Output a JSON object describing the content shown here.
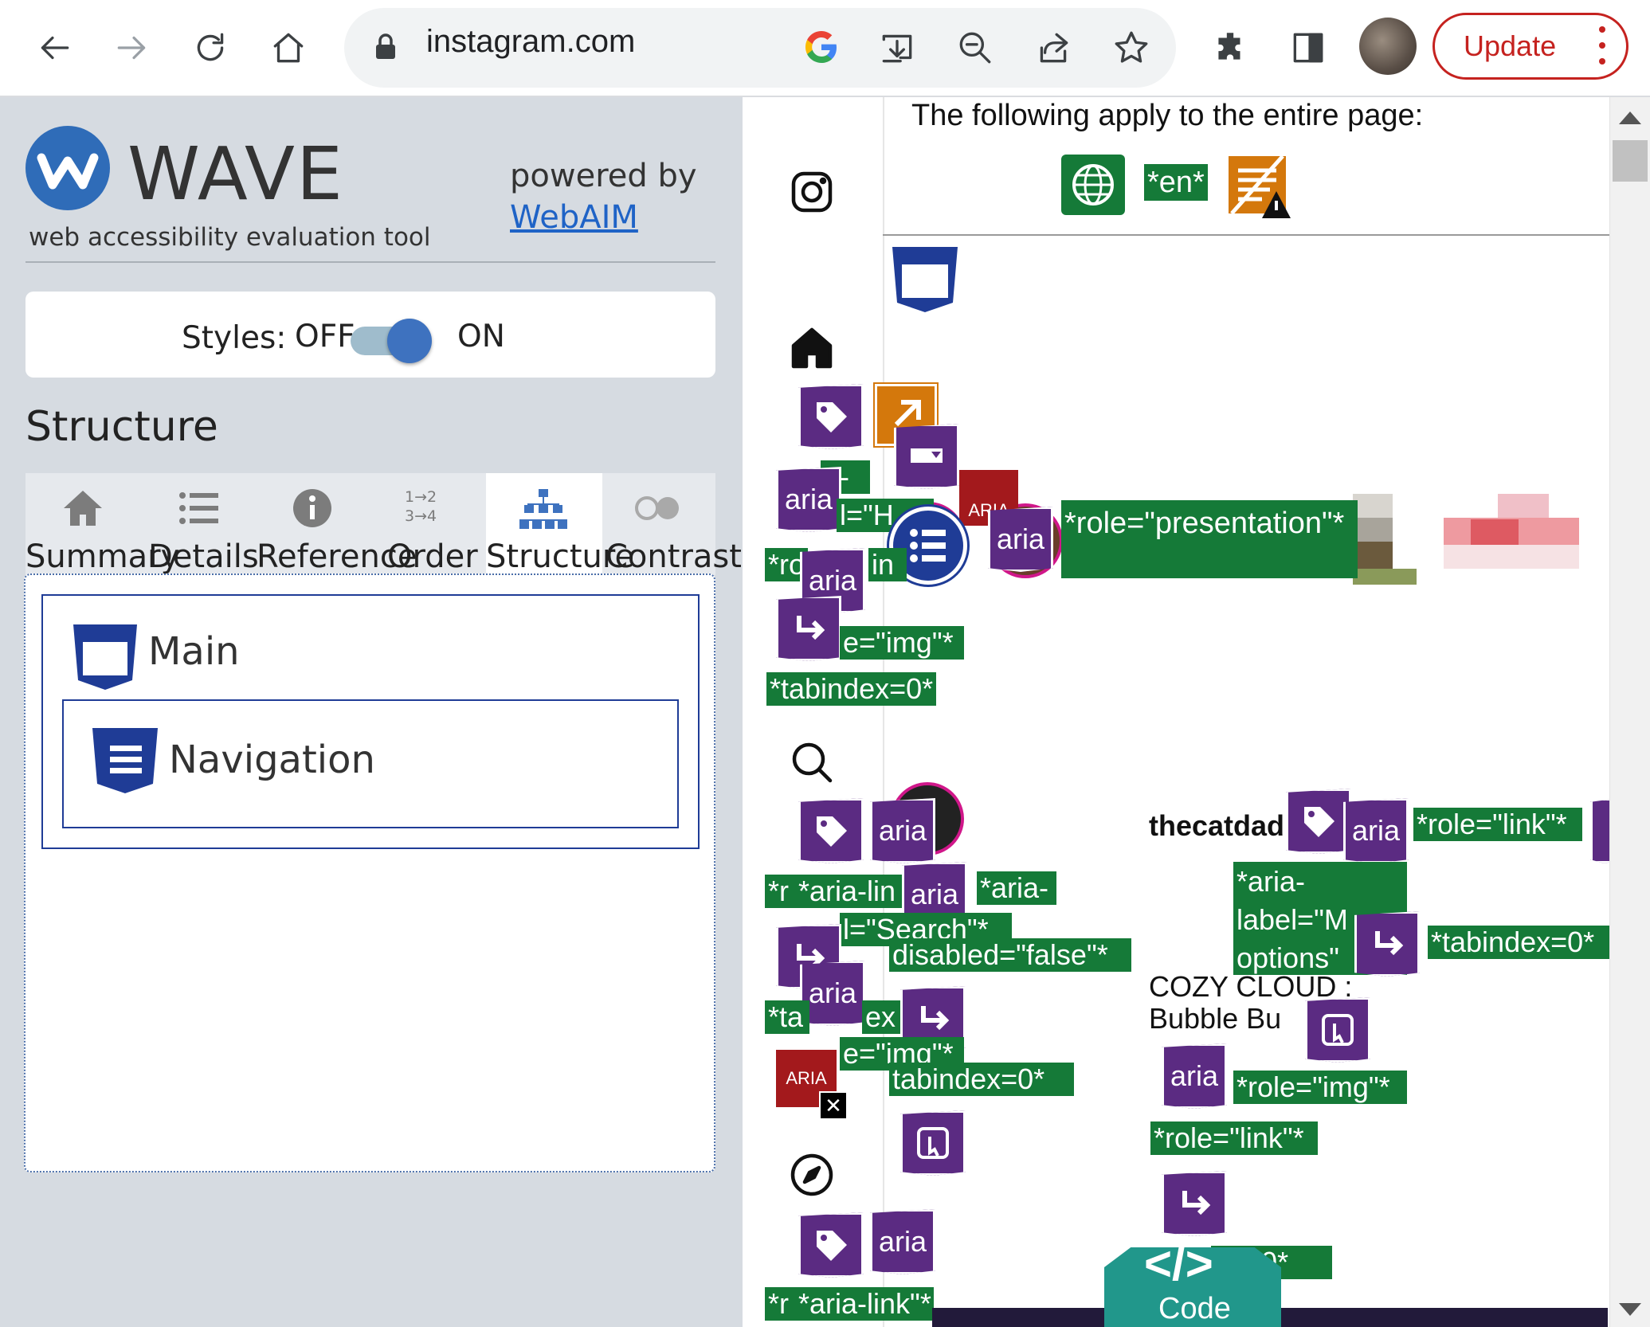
{
  "browser": {
    "url": "instagram.com",
    "update_label": "Update",
    "icons": [
      "back-icon",
      "forward-icon",
      "reload-icon",
      "home-icon",
      "lock-icon",
      "google-icon",
      "install-icon",
      "zoom-out-icon",
      "share-icon",
      "bookmark-star-icon",
      "extensions-icon",
      "side-panel-icon",
      "profile-avatar",
      "kebab-menu-icon"
    ]
  },
  "wave": {
    "title": "WAVE",
    "subtitle": "web accessibility evaluation tool",
    "powered_by": "powered by",
    "webaim_link": "WebAIM",
    "styles_label": "Styles:",
    "styles_off": "OFF",
    "styles_on": "ON",
    "section_heading": "Structure",
    "tabs": [
      {
        "label": "Summary",
        "active": false
      },
      {
        "label": "Details",
        "active": false
      },
      {
        "label": "Reference",
        "active": false
      },
      {
        "label": "Order",
        "active": false
      },
      {
        "label": "Structure",
        "active": true
      },
      {
        "label": "Contrast",
        "active": false
      }
    ],
    "order_icon_text": {
      "top": "1→2",
      "bottom": "3→4"
    },
    "structure_tree": {
      "main": "Main",
      "navigation": "Navigation"
    }
  },
  "page": {
    "apply_text": "The following apply to the entire page:",
    "lang_tag": "*en*",
    "username": "thecatdad",
    "post_line1": "COZY CLOUD :",
    "post_line2": "Bubble Bu",
    "code_symbol": "</>",
    "code_label": "Code",
    "aria_badge": "ARIA",
    "aria_text": "aria",
    "tags": {
      "role_presentation": "*role=\"presentation\"*",
      "role_img": "e=\"img\"*",
      "tabindex": "*tabindex=0*",
      "aria_link": "*aria-link",
      "aria_label_h": "l=\"H",
      "aria_partial": "a-",
      "rc": "*ro",
      "in": "in",
      "r": "*r",
      "aria_link2": "*aria-lin",
      "aria_dash": "*aria-",
      "search_label": "l=\"Search\"*",
      "disabled": "disabled=\"false\"*",
      "tab_partial": "*ta",
      "ex": "ex",
      "img2": "e=\"img\"*",
      "tabindex2": "tabindex=0*",
      "role_link": "*role=\"link\"*",
      "aria_label_m": "*aria-\nlabel=\"M\noptions\"",
      "tabindex3": "*tabindex=0*",
      "role_img2": "*role=\"img\"*",
      "role_link2": "*role=\"link\"*",
      "tabindex4": "ex=0*",
      "aria_link3": "*aria-link\"*",
      "r2": "*r"
    }
  }
}
